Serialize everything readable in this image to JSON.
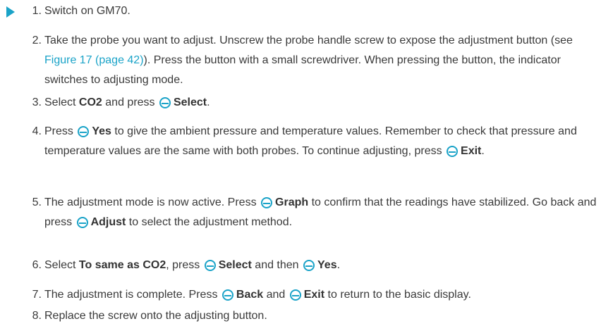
{
  "steps": [
    {
      "n": "1.",
      "parts": [
        {
          "t": "Switch on GM70."
        }
      ]
    },
    {
      "n": "2.",
      "parts": [
        {
          "t": "Take the probe you want to adjust. Unscrew the probe handle screw to expose the adjustment button (see "
        },
        {
          "t": "Figure 17 (page 42)",
          "link": true
        },
        {
          "t": "). Press the button with a small screwdriver. When pressing the button, the indicator switches to adjusting mode."
        }
      ]
    },
    {
      "n": "3.",
      "parts": [
        {
          "t": "Select "
        },
        {
          "t": "CO2",
          "b": true
        },
        {
          "t": " and press "
        },
        {
          "btn": true
        },
        {
          "t": "Select",
          "b": true
        },
        {
          "t": "."
        }
      ]
    },
    {
      "n": "4.",
      "parts": [
        {
          "t": "Press "
        },
        {
          "btn": true
        },
        {
          "t": "Yes",
          "b": true
        },
        {
          "t": " to give the ambient pressure and temperature values. Remember to check that pressure and temperature values are the same with both probes. To continue adjusting, press "
        },
        {
          "btn": true
        },
        {
          "t": "Exit",
          "b": true
        },
        {
          "t": "."
        }
      ]
    },
    {
      "n": "5.",
      "parts": [
        {
          "t": "The adjustment mode is now active. Press "
        },
        {
          "btn": true
        },
        {
          "t": "Graph",
          "b": true
        },
        {
          "t": " to confirm that the readings have stabilized. Go back and press "
        },
        {
          "btn": true
        },
        {
          "t": "Adjust",
          "b": true
        },
        {
          "t": " to select the adjustment method."
        }
      ]
    },
    {
      "n": "6.",
      "parts": [
        {
          "t": "Select "
        },
        {
          "t": "To same as CO2",
          "b": true
        },
        {
          "t": ", press "
        },
        {
          "btn": true
        },
        {
          "t": "Select",
          "b": true
        },
        {
          "t": " and then "
        },
        {
          "btn": true
        },
        {
          "t": "Yes",
          "b": true
        },
        {
          "t": "."
        }
      ]
    },
    {
      "n": "7.",
      "parts": [
        {
          "t": "The adjustment is complete. Press "
        },
        {
          "btn": true
        },
        {
          "t": "Back",
          "b": true
        },
        {
          "t": " and "
        },
        {
          "btn": true
        },
        {
          "t": "Exit",
          "b": true
        },
        {
          "t": " to return to the basic display."
        }
      ]
    },
    {
      "n": "8.",
      "parts": [
        {
          "t": "Replace the screw onto the adjusting button."
        }
      ]
    }
  ]
}
